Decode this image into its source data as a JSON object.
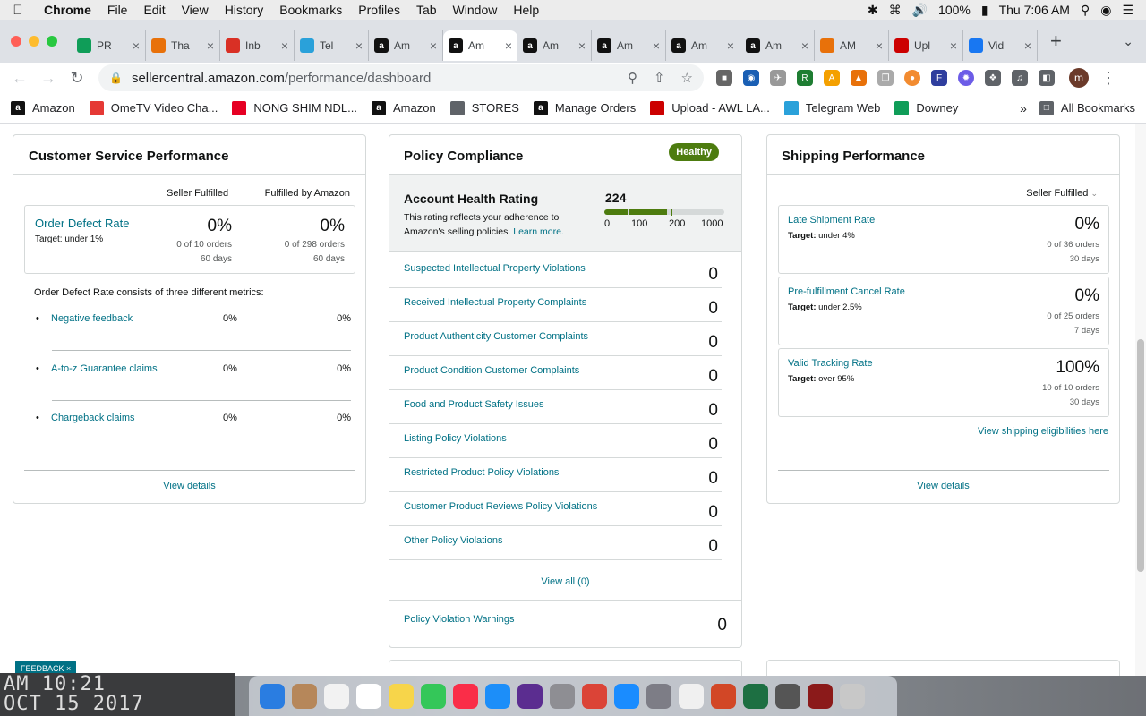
{
  "menubar": {
    "app": "Chrome",
    "items": [
      "File",
      "Edit",
      "View",
      "History",
      "Bookmarks",
      "Profiles",
      "Tab",
      "Window",
      "Help"
    ],
    "battery": "100%",
    "clock": "Thu 7:06 AM"
  },
  "tabs": [
    {
      "label": "PR",
      "icon": "sheets-icon",
      "color": "#0f9d58"
    },
    {
      "label": "Tha",
      "icon": "pencil-icon",
      "color": "#e8710a"
    },
    {
      "label": "Inb",
      "icon": "gmail-icon",
      "color": "#d93025"
    },
    {
      "label": "Tel",
      "icon": "telegram-icon",
      "color": "#2aa1da"
    },
    {
      "label": "Am",
      "icon": "amazon-icon",
      "color": "#111"
    },
    {
      "label": "Am",
      "icon": "amazon-icon",
      "color": "#111",
      "active": true
    },
    {
      "label": "Am",
      "icon": "amazon-icon",
      "color": "#111"
    },
    {
      "label": "Am",
      "icon": "amazon-icon",
      "color": "#111"
    },
    {
      "label": "Am",
      "icon": "amazon-icon",
      "color": "#111"
    },
    {
      "label": "Am",
      "icon": "amazon-icon",
      "color": "#111"
    },
    {
      "label": "AM",
      "icon": "pencil-icon",
      "color": "#e8710a"
    },
    {
      "label": "Upl",
      "icon": "awl-icon",
      "color": "#c00"
    },
    {
      "label": "Vid",
      "icon": "facebook-icon",
      "color": "#1877f2"
    }
  ],
  "address": {
    "host": "sellercentral.amazon.com",
    "path": "/performance/dashboard"
  },
  "bookmarks": [
    {
      "label": "Amazon",
      "icon": "amazon-icon",
      "color": "#111"
    },
    {
      "label": "OmeTV Video Cha...",
      "icon": "ometv-icon",
      "color": "#e53935"
    },
    {
      "label": "NONG SHIM NDL...",
      "icon": "pinterest-icon",
      "color": "#e60023"
    },
    {
      "label": "Amazon",
      "icon": "amazon-icon",
      "color": "#111"
    },
    {
      "label": "STORES",
      "icon": "folder-icon",
      "color": "#5f6368"
    },
    {
      "label": "Manage Orders",
      "icon": "amazon-icon",
      "color": "#111"
    },
    {
      "label": "Upload - AWL LA...",
      "icon": "awl-icon",
      "color": "#c00"
    },
    {
      "label": "Telegram Web",
      "icon": "telegram-icon",
      "color": "#2aa1da"
    },
    {
      "label": "Downey",
      "icon": "sheets-icon",
      "color": "#0f9d58"
    }
  ],
  "all_bookmarks": "All Bookmarks",
  "customer_service": {
    "title": "Customer Service Performance",
    "col1": "Seller Fulfilled",
    "col2": "Fulfilled by Amazon",
    "odr_label": "Order Defect Rate",
    "odr_target": "Target: under 1%",
    "odr_sf_value": "0%",
    "odr_sf_orders": "0 of 10 orders",
    "odr_sf_days": "60 days",
    "odr_fba_value": "0%",
    "odr_fba_orders": "0 of 298 orders",
    "odr_fba_days": "60 days",
    "metrics_intro": "Order Defect Rate consists of three different metrics:",
    "metrics": [
      {
        "label": "Negative feedback",
        "sf": "0%",
        "fba": "0%"
      },
      {
        "label": "A-to-z Guarantee claims",
        "sf": "0%",
        "fba": "0%"
      },
      {
        "label": "Chargeback claims",
        "sf": "0%",
        "fba": "0%"
      }
    ],
    "view_details": "View details"
  },
  "policy": {
    "title": "Policy Compliance",
    "badge": "Healthy",
    "ahr_title": "Account Health Rating",
    "ahr_desc": "This rating reflects your adherence to Amazon's selling policies.",
    "learn_more": "Learn more.",
    "ahr_score": "224",
    "ahr_score_value": 224,
    "scale": [
      "0",
      "100",
      "200",
      "1000"
    ],
    "rows": [
      {
        "label": "Suspected Intellectual Property Violations",
        "count": "0"
      },
      {
        "label": "Received Intellectual Property Complaints",
        "count": "0"
      },
      {
        "label": "Product Authenticity Customer Complaints",
        "count": "0"
      },
      {
        "label": "Product Condition Customer Complaints",
        "count": "0"
      },
      {
        "label": "Food and Product Safety Issues",
        "count": "0"
      },
      {
        "label": "Listing Policy Violations",
        "count": "0"
      },
      {
        "label": "Restricted Product Policy Violations",
        "count": "0"
      },
      {
        "label": "Customer Product Reviews Policy Violations",
        "count": "0"
      },
      {
        "label": "Other Policy Violations",
        "count": "0"
      }
    ],
    "view_all": "View all (0)",
    "warnings_label": "Policy Violation Warnings",
    "warnings_count": "0"
  },
  "shipping": {
    "title": "Shipping Performance",
    "filter": "Seller Fulfilled",
    "metrics": [
      {
        "label": "Late Shipment Rate",
        "target": "under 4%",
        "value": "0%",
        "orders": "0 of 36 orders",
        "days": "30 days"
      },
      {
        "label": "Pre-fulfillment Cancel Rate",
        "target": "under 2.5%",
        "value": "0%",
        "orders": "0 of 25 orders",
        "days": "7 days"
      },
      {
        "label": "Valid Tracking Rate",
        "target": "over 95%",
        "value": "100%",
        "orders": "10 of 10 orders",
        "days": "30 days"
      }
    ],
    "target_prefix": "Target:",
    "eligibility_link": "View shipping eligibilities here",
    "view_details": "View details"
  },
  "feedback": "FEEDBACK",
  "wallpaper_clock": {
    "line1": "AM 10:21",
    "line2": "OCT 15 2017"
  },
  "dock": [
    {
      "icon": "finder-icon",
      "color": "#2a7de1"
    },
    {
      "icon": "contacts-icon",
      "color": "#b6875a"
    },
    {
      "icon": "reminders-icon",
      "color": "#f2f2f2"
    },
    {
      "icon": "calendar-icon",
      "color": "#ffffff"
    },
    {
      "icon": "notes-icon",
      "color": "#f7d54a"
    },
    {
      "icon": "facetime-icon",
      "color": "#34c759"
    },
    {
      "icon": "music-icon",
      "color": "#fa2d48"
    },
    {
      "icon": "appstore-icon",
      "color": "#1c8ef9"
    },
    {
      "icon": "siri-icon",
      "color": "#5b2d90"
    },
    {
      "icon": "settings-icon",
      "color": "#8e8e93"
    },
    {
      "icon": "chrome-icon",
      "color": "#db4437"
    },
    {
      "icon": "safari-icon",
      "color": "#1a8cff"
    },
    {
      "icon": "launchpad-icon",
      "color": "#7d7d86"
    },
    {
      "icon": "photos-icon",
      "color": "#f0f0f0"
    },
    {
      "icon": "powerpoint-icon",
      "color": "#d24726"
    },
    {
      "icon": "excel-icon",
      "color": "#1d6f42"
    },
    {
      "icon": "calculator-icon",
      "color": "#555"
    },
    {
      "icon": "game-icon",
      "color": "#8b1a1a"
    },
    {
      "icon": "trash-icon",
      "color": "#c8c8c8"
    }
  ]
}
